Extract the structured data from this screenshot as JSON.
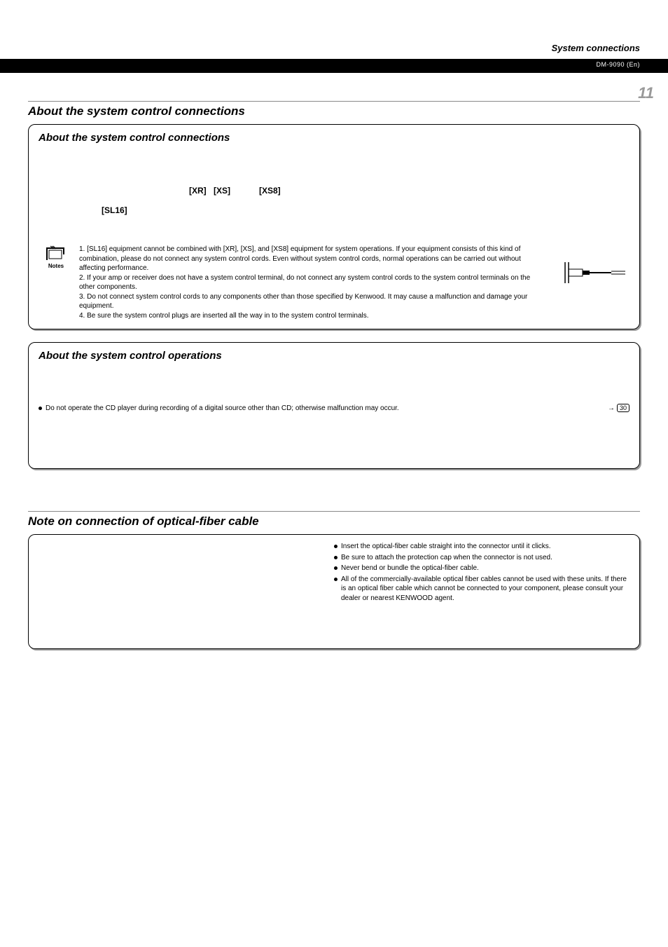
{
  "header": {
    "section": "System connections",
    "model": "DM-9090 (En)"
  },
  "page_number": "11",
  "main_heading": "About the system control connections",
  "panel1": {
    "title": "About the system control connections",
    "mark_xr": "[XR]",
    "mark_xs": "[XS]",
    "mark_xs8": "[XS8]",
    "mark_sl16": "[SL16]",
    "notes_label": "Notes",
    "notes": [
      "1. [SL16] equipment cannot be combined with [XR], [XS], and [XS8] equipment for system operations. If your equipment consists of this kind of combination, please do not connect any system control cords. Even without system control cords, normal operations can be carried out without affecting performance.",
      "2. If your amp or receiver does not have a system control terminal, do not connect any system control cords to the system control terminals on the other components.",
      "3. Do not connect system control cords to any components other than those specified by Kenwood. It may cause a malfunction and damage your equipment.",
      "4. Be sure the system control plugs are inserted all the way in to the system control terminals."
    ]
  },
  "panel2": {
    "title": "About the system control operations",
    "bullet": "Do not operate the CD player during recording of a digital source other than CD; otherwise malfunction may occur.",
    "page_ref": "30"
  },
  "panel3": {
    "heading": "Note on connection of optical-fiber cable",
    "bullets": [
      "Insert the optical-fiber cable straight into the connector until it clicks.",
      "Be sure to attach the protection cap when the connector is not used.",
      "Never bend or bundle the optical-fiber cable.",
      "All of the commercially-available optical fiber cables cannot be used with these units. If there is an optical fiber cable which cannot be connected to your component, please consult your dealer or nearest KENWOOD agent."
    ]
  }
}
